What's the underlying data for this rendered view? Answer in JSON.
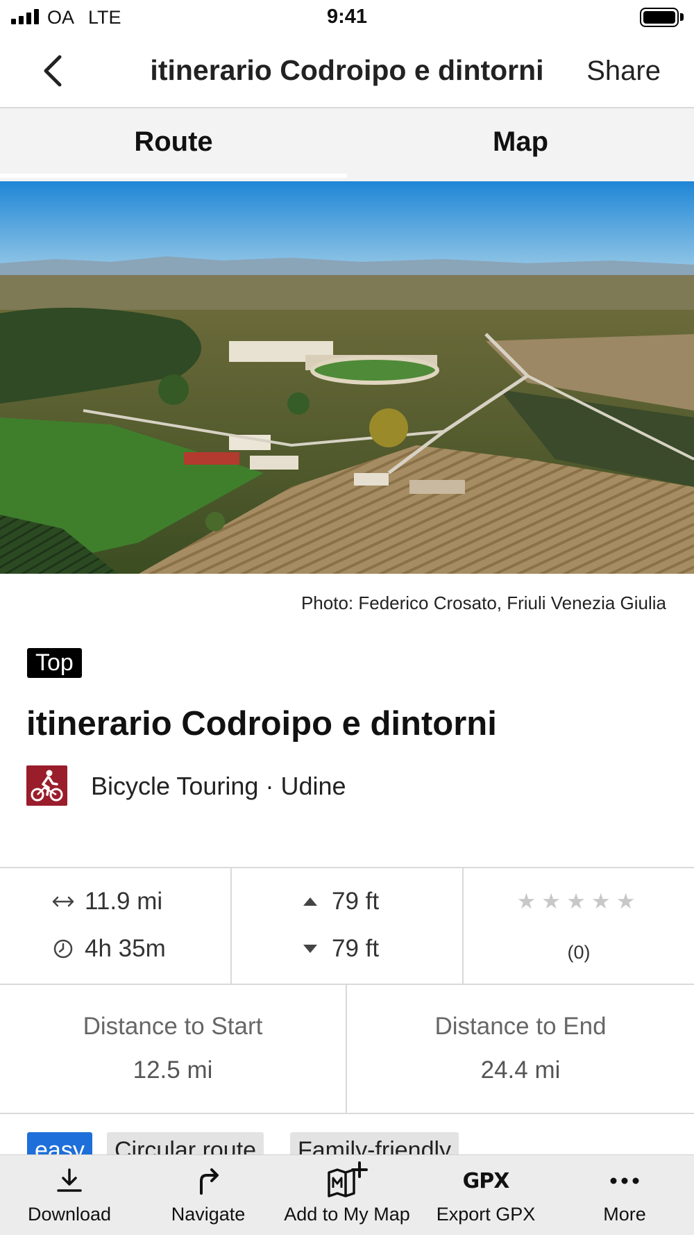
{
  "status_bar": {
    "carrier": "OA",
    "network": "LTE",
    "time": "9:41"
  },
  "nav": {
    "title": "itinerario Codroipo e dintorni",
    "share_label": "Share",
    "back_icon": "chevron-left-icon"
  },
  "tabs": [
    {
      "label": "Route",
      "selected": true
    },
    {
      "label": "Map",
      "selected": false
    }
  ],
  "hero": {
    "photo_credit": "Photo: Federico Crosato, Friuli Venezia Giulia"
  },
  "tour": {
    "badge": "Top",
    "title": "itinerario Codroipo e dintorni",
    "activity": "Bicycle Touring · Udine",
    "activity_icon": "bicycle-rider-icon",
    "activity_color": "#9a1d2b"
  },
  "stats": {
    "distance": "11.9 mi",
    "duration": "4h 35m",
    "ascent": "79 ft",
    "descent": "79 ft",
    "rating_stars": 0,
    "rating_count": "(0)"
  },
  "distances": {
    "start_label": "Distance to Start",
    "start_value": "12.5 mi",
    "end_label": "Distance to End",
    "end_value": "24.4 mi"
  },
  "chips": [
    {
      "label": "easy",
      "color": "#1e6fd9"
    },
    {
      "label": "Circular route"
    },
    {
      "label": "Family-friendly"
    }
  ],
  "toolbar": {
    "download": "Download",
    "navigate": "Navigate",
    "add_to_map": "Add to My Map",
    "export_gpx": "Export GPX",
    "export_gpx_icon_text": "GPX",
    "more": "More"
  }
}
